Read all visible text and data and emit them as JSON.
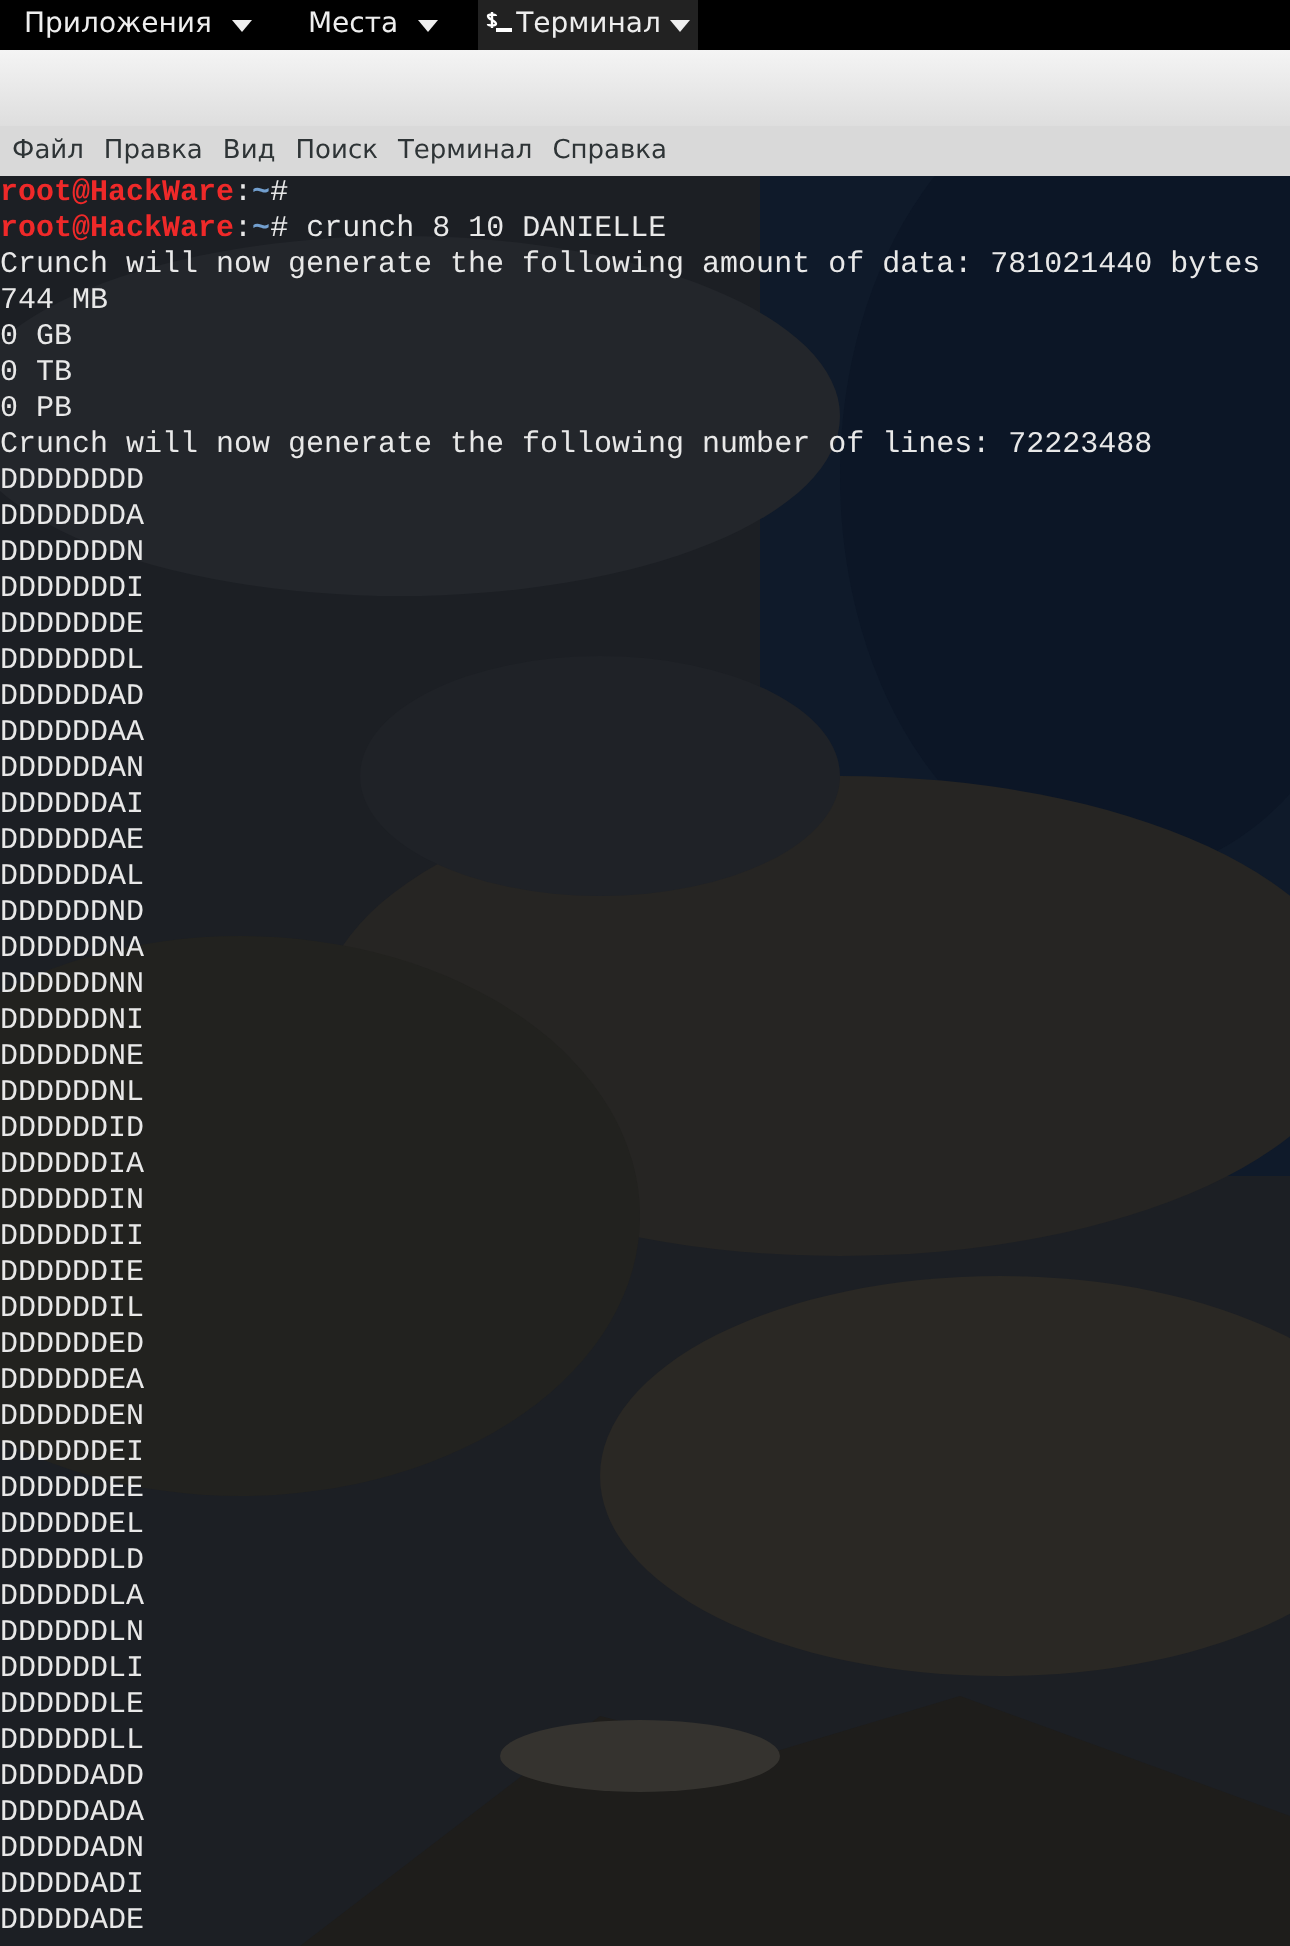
{
  "top_panel": {
    "menus": [
      {
        "label": "Приложения",
        "kind": "menu"
      },
      {
        "label": "Места",
        "kind": "menu"
      },
      {
        "label": "Терминал",
        "kind": "app"
      }
    ]
  },
  "menu_bar": {
    "items": [
      "Файл",
      "Правка",
      "Вид",
      "Поиск",
      "Терминал",
      "Справка"
    ]
  },
  "terminal": {
    "lines": [
      {
        "kind": "prompt",
        "user": "root@HackWare",
        "sep": ":",
        "path": "~",
        "symbol": "#"
      },
      {
        "kind": "prompt",
        "user": "root@HackWare",
        "sep": ":",
        "path": "~",
        "symbol": "#",
        "command": "crunch 8 10 DANIELLE"
      },
      {
        "kind": "output",
        "text": "Crunch will now generate the following amount of data: 781021440 bytes"
      },
      {
        "kind": "output",
        "text": "744 MB"
      },
      {
        "kind": "output",
        "text": "0 GB"
      },
      {
        "kind": "output",
        "text": "0 TB"
      },
      {
        "kind": "output",
        "text": "0 PB"
      },
      {
        "kind": "output",
        "text": "Crunch will now generate the following number of lines: 72223488"
      },
      {
        "kind": "output",
        "text": "DDDDDDDD"
      },
      {
        "kind": "output",
        "text": "DDDDDDDA"
      },
      {
        "kind": "output",
        "text": "DDDDDDDN"
      },
      {
        "kind": "output",
        "text": "DDDDDDDI"
      },
      {
        "kind": "output",
        "text": "DDDDDDDE"
      },
      {
        "kind": "output",
        "text": "DDDDDDDL"
      },
      {
        "kind": "output",
        "text": "DDDDDDAD"
      },
      {
        "kind": "output",
        "text": "DDDDDDAA"
      },
      {
        "kind": "output",
        "text": "DDDDDDAN"
      },
      {
        "kind": "output",
        "text": "DDDDDDAI"
      },
      {
        "kind": "output",
        "text": "DDDDDDAE"
      },
      {
        "kind": "output",
        "text": "DDDDDDAL"
      },
      {
        "kind": "output",
        "text": "DDDDDDND"
      },
      {
        "kind": "output",
        "text": "DDDDDDNA"
      },
      {
        "kind": "output",
        "text": "DDDDDDNN"
      },
      {
        "kind": "output",
        "text": "DDDDDDNI"
      },
      {
        "kind": "output",
        "text": "DDDDDDNE"
      },
      {
        "kind": "output",
        "text": "DDDDDDNL"
      },
      {
        "kind": "output",
        "text": "DDDDDDID"
      },
      {
        "kind": "output",
        "text": "DDDDDDIA"
      },
      {
        "kind": "output",
        "text": "DDDDDDIN"
      },
      {
        "kind": "output",
        "text": "DDDDDDII"
      },
      {
        "kind": "output",
        "text": "DDDDDDIE"
      },
      {
        "kind": "output",
        "text": "DDDDDDIL"
      },
      {
        "kind": "output",
        "text": "DDDDDDED"
      },
      {
        "kind": "output",
        "text": "DDDDDDEA"
      },
      {
        "kind": "output",
        "text": "DDDDDDEN"
      },
      {
        "kind": "output",
        "text": "DDDDDDEI"
      },
      {
        "kind": "output",
        "text": "DDDDDDEE"
      },
      {
        "kind": "output",
        "text": "DDDDDDEL"
      },
      {
        "kind": "output",
        "text": "DDDDDDLD"
      },
      {
        "kind": "output",
        "text": "DDDDDDLA"
      },
      {
        "kind": "output",
        "text": "DDDDDDLN"
      },
      {
        "kind": "output",
        "text": "DDDDDDLI"
      },
      {
        "kind": "output",
        "text": "DDDDDDLE"
      },
      {
        "kind": "output",
        "text": "DDDDDDLL"
      },
      {
        "kind": "output",
        "text": "DDDDDADD"
      },
      {
        "kind": "output",
        "text": "DDDDDADA"
      },
      {
        "kind": "output",
        "text": "DDDDDADN"
      },
      {
        "kind": "output",
        "text": "DDDDDADI"
      },
      {
        "kind": "output",
        "text": "DDDDDADE"
      }
    ]
  }
}
